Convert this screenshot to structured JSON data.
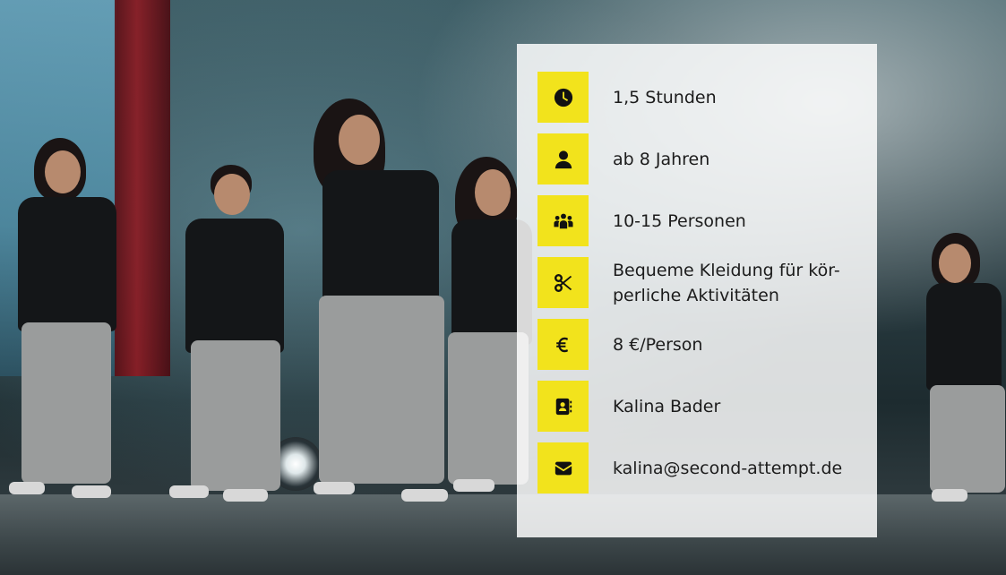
{
  "info": {
    "items": [
      {
        "icon": "clock-icon",
        "text": "1,5 Stunden"
      },
      {
        "icon": "person-icon",
        "text": "ab 8 Jahren"
      },
      {
        "icon": "group-icon",
        "text": "10-15 Personen"
      },
      {
        "icon": "scissors-icon",
        "text": "Bequeme Kleidung für kör-perliche Aktivitäten"
      },
      {
        "icon": "euro-icon",
        "text": "8 €/Person"
      },
      {
        "icon": "contact-card-icon",
        "text": "Kalina Bader"
      },
      {
        "icon": "envelope-icon",
        "text": "kalina@second-attempt.de"
      }
    ]
  },
  "colors": {
    "icon_background": "#f2e31c",
    "card_background": "#ffffff",
    "text": "#1c1c1c"
  }
}
